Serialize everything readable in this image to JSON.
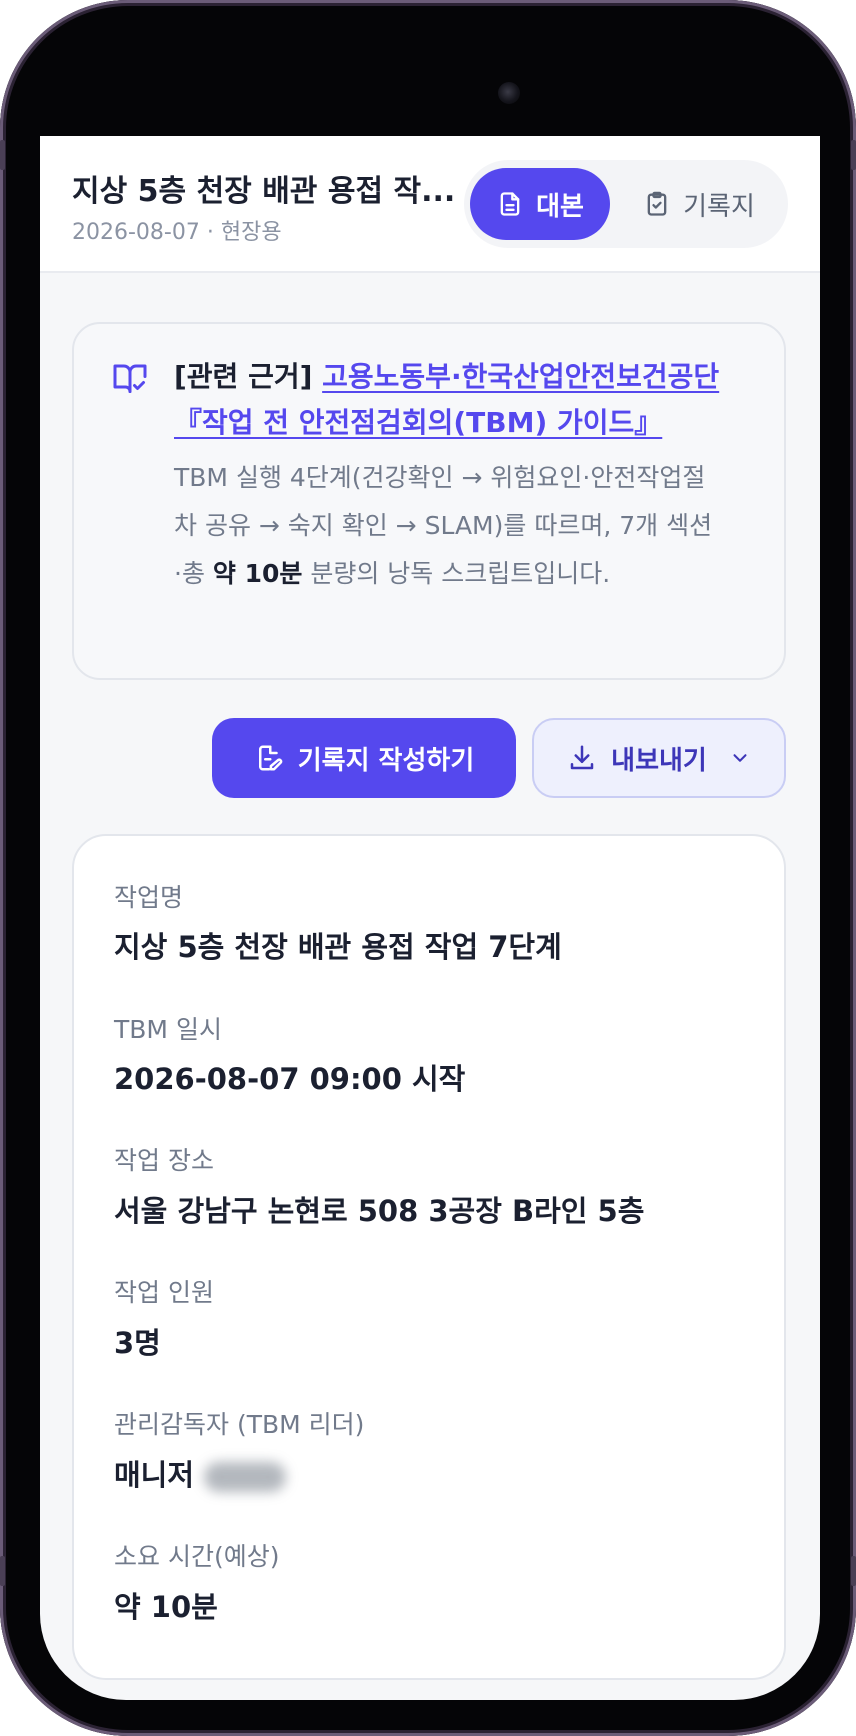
{
  "header": {
    "title": "지상 5층 천장 배관 용접 작...",
    "subtitle": "2026-08-07 · 현장용",
    "tabs": [
      {
        "label": "대본",
        "icon": "document-icon",
        "active": true
      },
      {
        "label": "기록지",
        "icon": "clipboard-check-icon",
        "active": false
      }
    ]
  },
  "notice": {
    "icon": "book-check-icon",
    "prefix": "[관련 근거]",
    "link_text": "고용노동부·한국산업안전보건공단 『작업 전 안전점검회의(TBM) 가이드』",
    "body_before": "TBM 실행 4단계(건강확인 → 위험요인·안전작업절차 공유 → 숙지 확인 → SLAM)를 따르며, 7개 섹션·총 ",
    "body_bold": "약 10분",
    "body_after": " 분량의 낭독 스크립트입니다."
  },
  "actions": {
    "write_record": "기록지 작성하기",
    "export": "내보내기"
  },
  "info": {
    "fields": [
      {
        "label": "작업명",
        "value": "지상 5층 천장 배관 용접 작업 7단계"
      },
      {
        "label": "TBM 일시",
        "value": "2026-08-07 09:00 시작"
      },
      {
        "label": "작업 장소",
        "value": "서울 강남구 논현로 508 3공장 B라인 5층"
      },
      {
        "label": "작업 인원",
        "value": "3명"
      },
      {
        "label": "관리감독자 (TBM 리더)",
        "value": "매니저"
      },
      {
        "label": "소요 시간(예상)",
        "value": "약 10분"
      }
    ]
  },
  "colors": {
    "accent": "#5548ee",
    "text_primary": "#1b2030",
    "text_secondary": "#717a8b"
  }
}
